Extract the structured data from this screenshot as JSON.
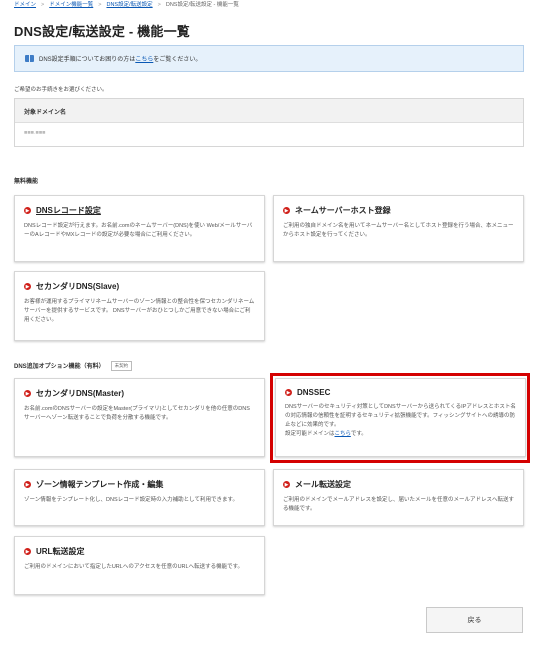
{
  "breadcrumb": [
    "ドメイン",
    "ドメイン機能一覧",
    "DNS設定/転送設定",
    "DNS設定/転送設定 - 機能一覧"
  ],
  "page_title": "DNS設定/転送設定 - 機能一覧",
  "notice": {
    "prefix": "DNS設定手順についてお困りの方は",
    "link": "こちら",
    "suffix": "をご覧ください。"
  },
  "intro": "ご希望のお手続きをお選びください。",
  "target_domain": {
    "label": "対象ドメイン名",
    "value": "■■■.■■■"
  },
  "sections": {
    "free": "無料機能",
    "option": "DNS追加オプション機能（有料）",
    "option_badge": "未契約"
  },
  "cards": {
    "dns_record": {
      "title": "DNSレコード設定",
      "desc": "DNSレコード設定が行えます。お名前.comのネームサーバー(DNS)を使い Web/メールサーバーのAレコードやMXレコードの設定が必要な場合にご利用ください。"
    },
    "ns_host": {
      "title": "ネームサーバーホスト登録",
      "desc": "ご利用の独自ドメイン名を用いてネームサーバー名としてホスト登録を行う場合、本メニューからホスト設定を行ってください。"
    },
    "secondary_slave": {
      "title": "セカンダリDNS(Slave)",
      "desc": "お客様が運用するプライマリネームサーバーのゾーン情報との整合性を保つセカンダリネームサーバーを提供するサービスです。 DNSサーバーがおひとつしかご用意できない場合にご利用ください。"
    },
    "secondary_master": {
      "title": "セカンダリDNS(Master)",
      "desc": "お名前.comのDNSサーバーの設定をMaster(プライマリ)としてセカンダリを他の任意のDNSサーバーへゾーン転送することで負荷を分散する機能です。"
    },
    "dnssec": {
      "title": "DNSSEC",
      "desc": "DNSサーバーのセキュリティ対策としてDNSサーバーから送られてくるIPアドレスとホスト名の対応情報の信頼性を証明するセキュリティ拡張機能です。フィッシングサイトへの誘導の防止などに効果的です。",
      "link_prefix": "設定可能ドメインは",
      "link": "こちら",
      "link_suffix": "です。"
    },
    "zone_template": {
      "title": "ゾーン情報テンプレート作成・編集",
      "desc": "ゾーン情報をテンプレート化し、DNSレコード設定時の入力補助として利用できます。"
    },
    "mail_forward": {
      "title": "メール転送設定",
      "desc": "ご利用のドメインでメールアドレスを設定し、届いたメールを任意のメールアドレスへ転送する機能です。"
    },
    "url_forward": {
      "title": "URL転送設定",
      "desc": "ご利用のドメインにおいて指定したURLへのアクセスを任意のURLへ転送する機能です。"
    }
  },
  "back_button": "戻る",
  "colors": {
    "accent_red": "#d0201a",
    "highlight_red": "#d40000",
    "link_blue": "#0a58b5",
    "notice_bg": "#e6f1fb"
  }
}
